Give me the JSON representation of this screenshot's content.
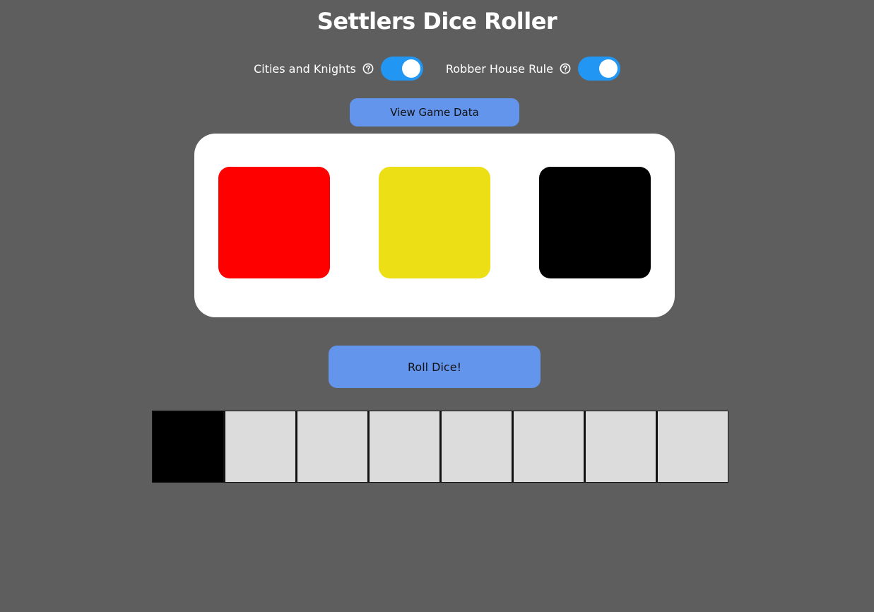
{
  "header": {
    "title": "Settlers Dice Roller"
  },
  "options": [
    {
      "label": "Cities and Knights",
      "enabled": true,
      "icon": "help-circle-icon"
    },
    {
      "label": "Robber House Rule",
      "enabled": true,
      "icon": "help-circle-icon"
    }
  ],
  "buttons": {
    "view_game_data": "View Game Data",
    "roll_dice": "Roll Dice!"
  },
  "dice": [
    {
      "name": "red-die",
      "color": "#ff0000"
    },
    {
      "name": "yellow-die",
      "color": "#eddf15"
    },
    {
      "name": "event-die",
      "color": "#000000"
    }
  ],
  "barbarian_track": {
    "cells": 8,
    "active_position": 1,
    "active_color": "#000000",
    "inactive_color": "#dcdcdc"
  },
  "colors": {
    "background": "#5e5e5e",
    "accent": "#6495ed",
    "toggle_on": "#2196f3"
  }
}
